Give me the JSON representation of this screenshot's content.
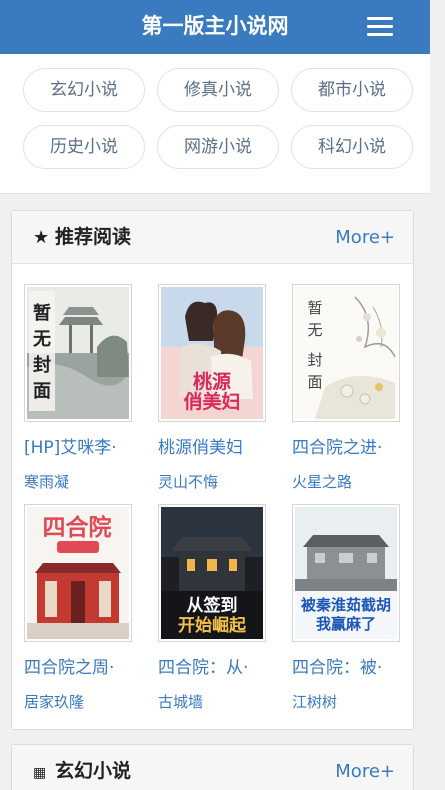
{
  "header": {
    "title": "第一版主小说网",
    "menu_icon": "hamburger-menu-icon"
  },
  "categories": [
    "玄幻小说",
    "修真小说",
    "都市小说",
    "历史小说",
    "网游小说",
    "科幻小说"
  ],
  "recommend": {
    "title": "推荐阅读",
    "icon": "star-icon",
    "more": "More+",
    "books": [
      {
        "title": "[HP]艾咪李·",
        "author": "寒雨凝",
        "cover_text": "暂无封面"
      },
      {
        "title": "桃源俏美妇",
        "author": "灵山不悔",
        "cover_text": "桃源俏美妇"
      },
      {
        "title": "四合院之进·",
        "author": "火星之路",
        "cover_text": "暂无封面"
      },
      {
        "title": "四合院之周·",
        "author": "居家玖隆",
        "cover_text": "四合院"
      },
      {
        "title": "四合院：从·",
        "author": "古城墙",
        "cover_text": "从签到开始崛起"
      },
      {
        "title": "四合院：被·",
        "author": "江树树",
        "cover_text": "被秦淮茹截胡我赢麻了"
      }
    ]
  },
  "xuanhuan": {
    "title": "玄幻小说",
    "icon": "grid-icon",
    "more": "More+"
  }
}
